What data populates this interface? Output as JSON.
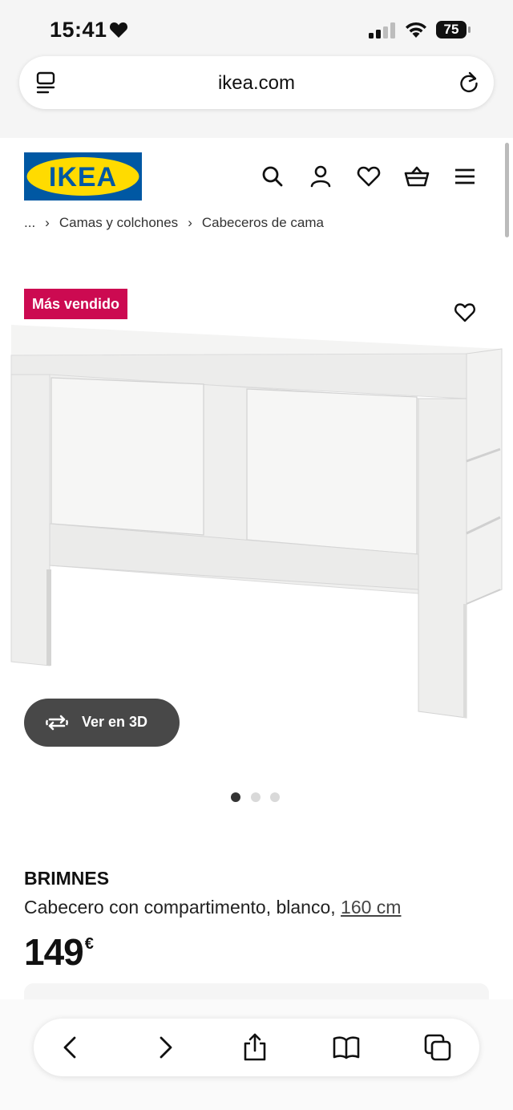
{
  "status_bar": {
    "time": "15:41",
    "battery": "75"
  },
  "browser": {
    "url": "ikea.com"
  },
  "header": {
    "logo_text": "IKEA",
    "brand_colors": {
      "blue": "#0058a3",
      "yellow": "#ffdb00"
    },
    "icons": [
      "search-icon",
      "account-icon",
      "heart-icon",
      "basket-icon",
      "menu-icon"
    ]
  },
  "breadcrumb": [
    "...",
    "Camas y colchones",
    "Cabeceros de cama"
  ],
  "product": {
    "badge": "Más vendido",
    "badge_color": "#cc0a51",
    "view_3d_label": "Ver en 3D",
    "image_count": 3,
    "active_image": 1,
    "name": "BRIMNES",
    "description": "Cabecero con compartimento, blanco, ",
    "size": "160 cm",
    "price": "149",
    "currency": "€"
  },
  "bottom_bar": {
    "icons": [
      "back-icon",
      "forward-icon",
      "share-icon",
      "bookmarks-icon",
      "tabs-icon"
    ]
  }
}
